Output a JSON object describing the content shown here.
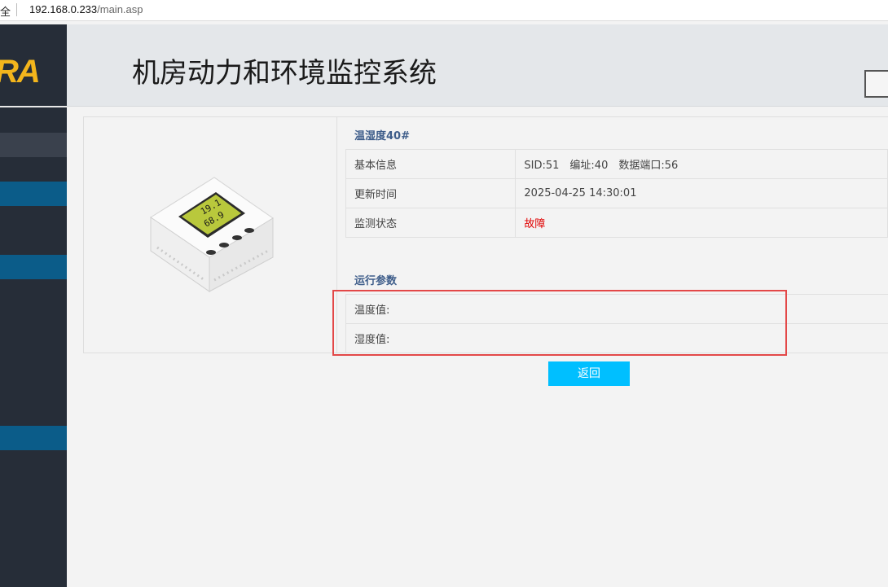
{
  "browser": {
    "security_label": "全",
    "url_host": "192.168.0.233",
    "url_path": "/main.asp"
  },
  "sidebar": {
    "logo_text": "RA"
  },
  "header": {
    "title": "机房动力和环境监控系统"
  },
  "device": {
    "name": "温湿度40#",
    "icon": "thermo-hygrometer-device",
    "lcd_temp": "19.1",
    "lcd_hum": "68.9",
    "info": [
      {
        "label": "基本信息",
        "value": "SID:51　编址:40　数据端口:56"
      },
      {
        "label": "更新时间",
        "value": "2025-04-25 14:30:01"
      },
      {
        "label": "监测状态",
        "value": "故障"
      }
    ],
    "status_color": "#e00000"
  },
  "params": {
    "title": "运行参数",
    "rows": [
      {
        "label": "温度值:"
      },
      {
        "label": "湿度值:"
      }
    ]
  },
  "actions": {
    "back_label": "返回"
  },
  "colors": {
    "sidebar_bg": "#262d38",
    "sidebar_active": "#0b5c89",
    "logo": "#f3b51c",
    "button": "#00bfff",
    "highlight": "#e34848"
  }
}
